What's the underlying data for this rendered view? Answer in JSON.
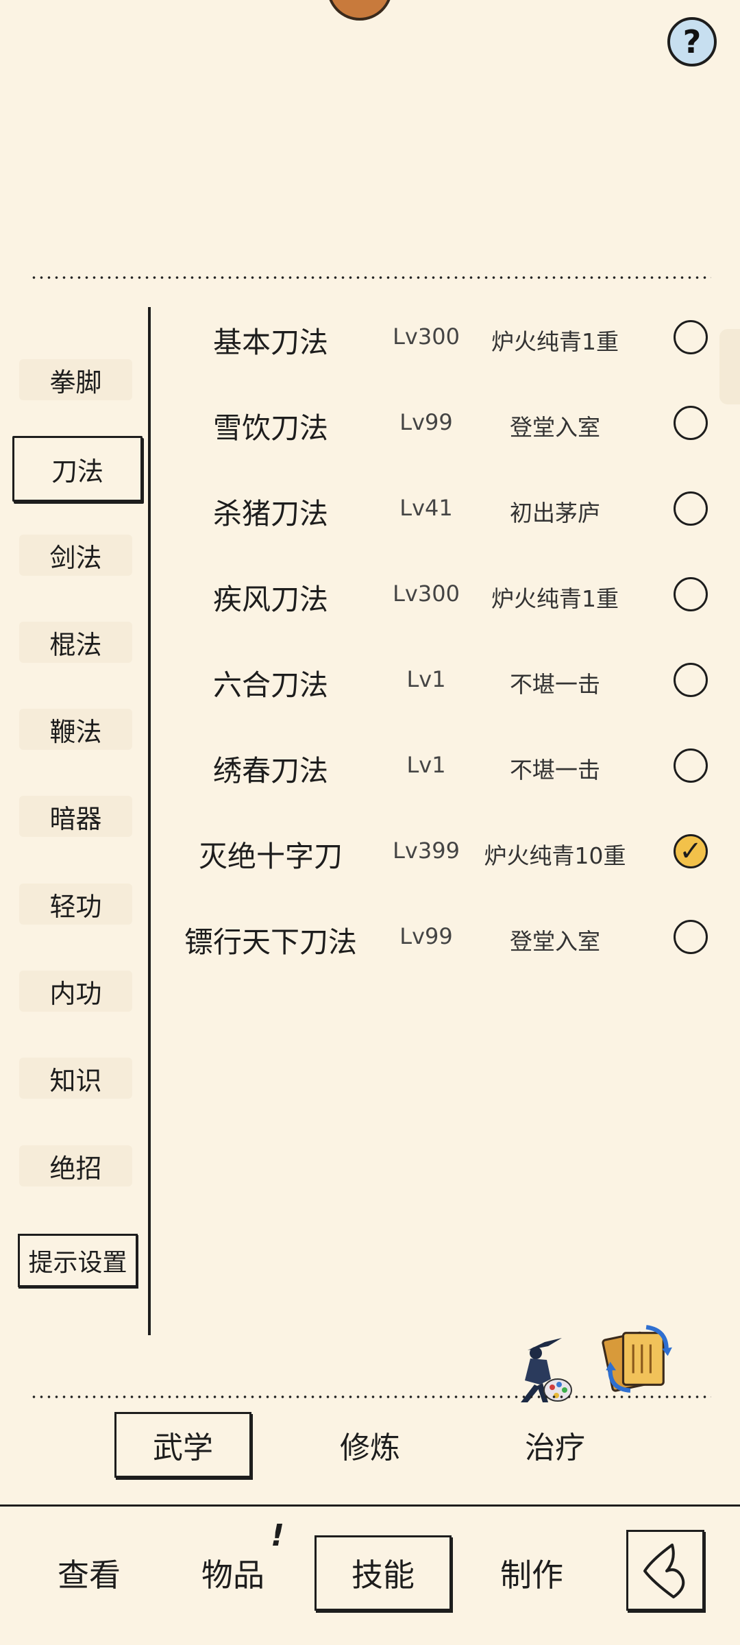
{
  "header": {
    "help_label": "?"
  },
  "sidebar": {
    "items": [
      {
        "label": "拳脚",
        "active": false
      },
      {
        "label": "刀法",
        "active": true
      },
      {
        "label": "剑法",
        "active": false
      },
      {
        "label": "棍法",
        "active": false
      },
      {
        "label": "鞭法",
        "active": false
      },
      {
        "label": "暗器",
        "active": false
      },
      {
        "label": "轻功",
        "active": false
      },
      {
        "label": "内功",
        "active": false
      },
      {
        "label": "知识",
        "active": false
      },
      {
        "label": "绝招",
        "active": false
      }
    ],
    "hint_settings_label": "提示设置"
  },
  "skills": [
    {
      "name": "基本刀法",
      "level": "Lv300",
      "rank": "炉火纯青1重",
      "equipped": false
    },
    {
      "name": "雪饮刀法",
      "level": "Lv99",
      "rank": "登堂入室",
      "equipped": false
    },
    {
      "name": "杀猪刀法",
      "level": "Lv41",
      "rank": "初出茅庐",
      "equipped": false
    },
    {
      "name": "疾风刀法",
      "level": "Lv300",
      "rank": "炉火纯青1重",
      "equipped": false
    },
    {
      "name": "六合刀法",
      "level": "Lv1",
      "rank": "不堪一击",
      "equipped": false
    },
    {
      "name": "绣春刀法",
      "level": "Lv1",
      "rank": "不堪一击",
      "equipped": false
    },
    {
      "name": "灭绝十字刀",
      "level": "Lv399",
      "rank": "炉火纯青10重",
      "equipped": true
    },
    {
      "name": "镖行天下刀法",
      "level": "Lv99",
      "rank": "登堂入室",
      "equipped": false
    }
  ],
  "subtabs": [
    {
      "label": "武学",
      "active": true
    },
    {
      "label": "修炼",
      "active": false
    },
    {
      "label": "治疗",
      "active": false
    }
  ],
  "bottom_nav": {
    "items": [
      {
        "label": "查看",
        "active": false
      },
      {
        "label": "物品",
        "active": false
      },
      {
        "label": "技能",
        "active": true
      },
      {
        "label": "制作",
        "active": false
      }
    ],
    "items_alert": "!"
  },
  "icons": {
    "help": "question-icon",
    "ninja": "ninja-palette-icon",
    "book": "book-swap-icon",
    "back": "back-arrow-icon"
  },
  "colors": {
    "background": "#fbf3e3",
    "ink": "#1d1d1d",
    "check_on": "#f2c14a",
    "help_bg": "#c7dff0"
  }
}
